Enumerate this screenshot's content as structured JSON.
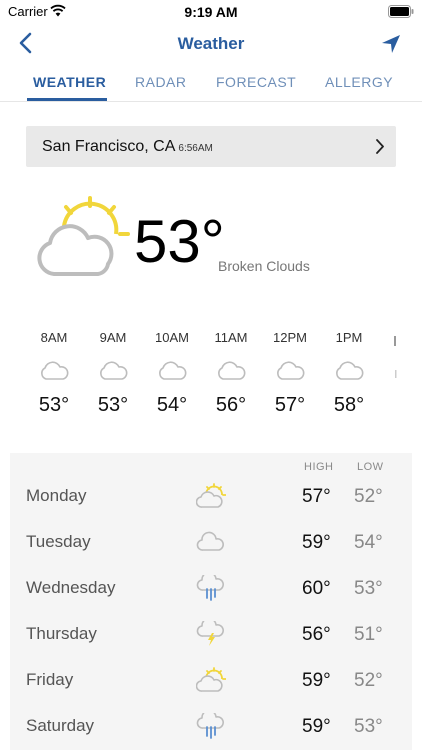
{
  "status": {
    "carrier": "Carrier",
    "time": "9:19 AM"
  },
  "nav": {
    "title": "Weather"
  },
  "tabs": [
    {
      "label": "WEATHER",
      "active": true
    },
    {
      "label": "RADAR",
      "active": false
    },
    {
      "label": "FORECAST",
      "active": false
    },
    {
      "label": "ALLERGY",
      "active": false
    }
  ],
  "location": {
    "city": "San Francisco, CA",
    "time": "6:56AM"
  },
  "current": {
    "temp": "53°",
    "condition": "Broken Clouds",
    "icon": "partly-cloudy-icon"
  },
  "hourly": [
    {
      "time": "8AM",
      "temp": "53°",
      "icon": "cloud-icon"
    },
    {
      "time": "9AM",
      "temp": "53°",
      "icon": "cloud-icon"
    },
    {
      "time": "10AM",
      "temp": "54°",
      "icon": "cloud-icon"
    },
    {
      "time": "11AM",
      "temp": "56°",
      "icon": "cloud-icon"
    },
    {
      "time": "12PM",
      "temp": "57°",
      "icon": "cloud-icon"
    },
    {
      "time": "1PM",
      "temp": "58°",
      "icon": "cloud-icon"
    }
  ],
  "daily_header": {
    "high": "HIGH",
    "low": "LOW"
  },
  "daily": [
    {
      "day": "Monday",
      "high": "57°",
      "low": "52°",
      "icon": "partly-cloudy-icon"
    },
    {
      "day": "Tuesday",
      "high": "59°",
      "low": "54°",
      "icon": "cloud-icon"
    },
    {
      "day": "Wednesday",
      "high": "60°",
      "low": "53°",
      "icon": "rain-icon"
    },
    {
      "day": "Thursday",
      "high": "56°",
      "low": "51°",
      "icon": "thunderstorm-icon"
    },
    {
      "day": "Friday",
      "high": "59°",
      "low": "52°",
      "icon": "partly-cloudy-icon"
    },
    {
      "day": "Saturday",
      "high": "59°",
      "low": "53°",
      "icon": "rain-icon"
    }
  ],
  "colors": {
    "accent": "#2a5d9f",
    "tab_inactive": "#6f8fb8",
    "sun": "#f1d63b",
    "rain": "#5a8fd0",
    "cloud": "#bdbdbd"
  }
}
